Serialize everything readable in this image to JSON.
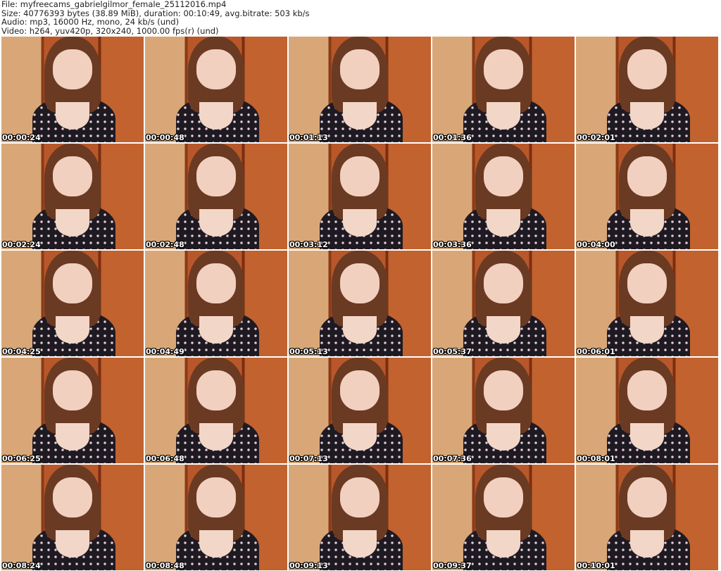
{
  "header": {
    "file": "File: myfreecams_gabrielgilmor_female_25112016.mp4",
    "size": "Size: 40776393 bytes (38.89 MiB), duration: 00:10:49, avg.bitrate: 503 kb/s",
    "audio": "Audio: mp3, 16000 Hz, mono, 24 kb/s (und)",
    "video": "Video: h264, yuv420p, 320x240, 1000.00 fps(r) (und)"
  },
  "timestamps": [
    "00:00:24",
    "00:00:48",
    "00:01:13",
    "00:01:36",
    "00:02:01",
    "00:02:24",
    "00:02:48",
    "00:03:12",
    "00:03:36",
    "00:04:00",
    "00:04:25",
    "00:04:49",
    "00:05:13",
    "00:05:37",
    "00:06:01",
    "00:06:25",
    "00:06:48",
    "00:07:13",
    "00:07:36",
    "00:08:01",
    "00:08:24",
    "00:08:48",
    "00:09:13",
    "00:09:37",
    "00:10:01"
  ]
}
